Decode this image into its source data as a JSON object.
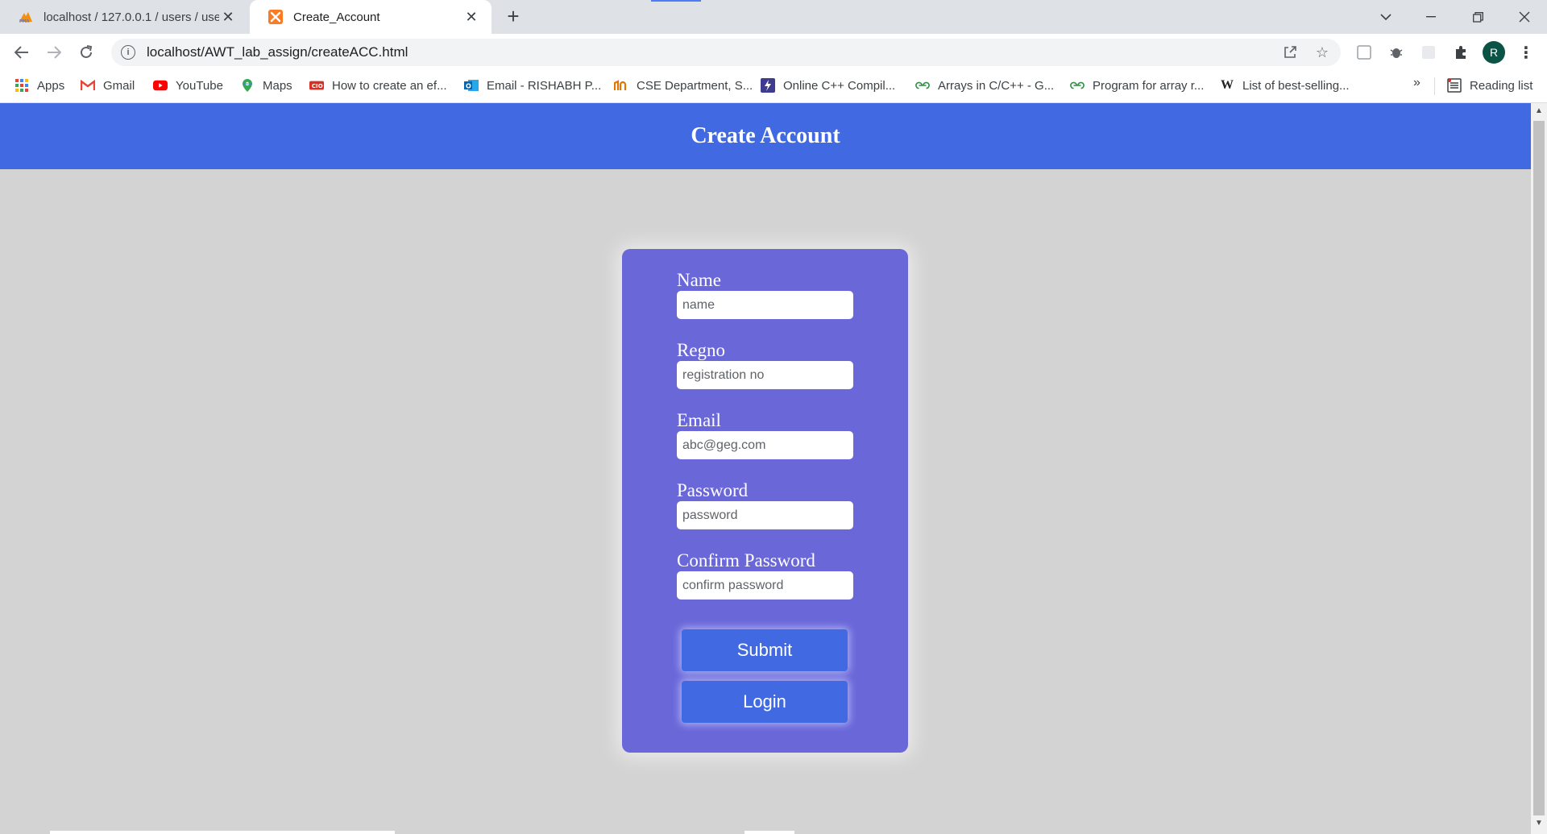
{
  "browser": {
    "tabs": [
      {
        "title": "localhost / 127.0.0.1 / users / use",
        "active": false,
        "icon": "phpmyadmin-icon"
      },
      {
        "title": "Create_Account",
        "active": true,
        "icon": "xampp-icon"
      }
    ],
    "new_tab_symbol": "+",
    "url": "localhost/AWT_lab_assign/createACC.html",
    "profile_initial": "R",
    "bookmarks": [
      {
        "label": "Apps",
        "icon": "apps-grid-icon"
      },
      {
        "label": "Gmail",
        "icon": "gmail-icon"
      },
      {
        "label": "YouTube",
        "icon": "youtube-icon"
      },
      {
        "label": "Maps",
        "icon": "maps-icon"
      },
      {
        "label": "How to create an ef...",
        "icon": "bookmark-site-icon"
      },
      {
        "label": "Email - RISHABH P...",
        "icon": "outlook-icon"
      },
      {
        "label": "CSE Department, S...",
        "icon": "university-icon"
      },
      {
        "label": "Online C++ Compil...",
        "icon": "compiler-icon"
      },
      {
        "label": "Arrays in C/C++ - G...",
        "icon": "geeksforgeeks-icon"
      },
      {
        "label": "Program for array r...",
        "icon": "geeksforgeeks-icon"
      },
      {
        "label": "List of best-selling...",
        "icon": "wikipedia-icon"
      }
    ],
    "bookmarks_more": "»",
    "reading_list": "Reading list"
  },
  "page": {
    "title": "Create Account",
    "colors": {
      "header": "#4169e1",
      "card": "#6a67d9",
      "background": "#d3d3d3",
      "button": "#4169e1"
    },
    "form": {
      "fields": [
        {
          "label": "Name",
          "placeholder": "name"
        },
        {
          "label": "Regno",
          "placeholder": "registration no"
        },
        {
          "label": "Email",
          "placeholder": "abc@geg.com"
        },
        {
          "label": "Password",
          "placeholder": "password"
        },
        {
          "label": "Confirm Password",
          "placeholder": "confirm password"
        }
      ],
      "submit_label": "Submit",
      "login_label": "Login"
    }
  }
}
